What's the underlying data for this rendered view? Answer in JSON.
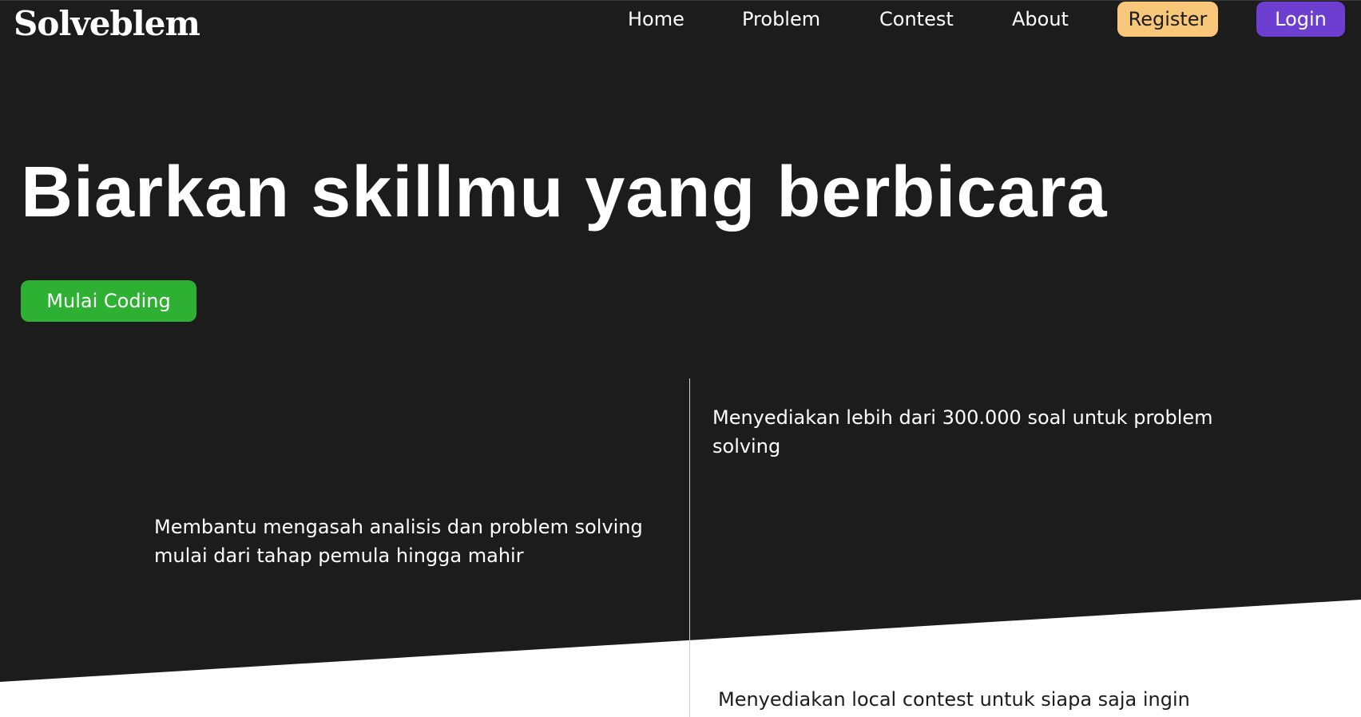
{
  "header": {
    "logo": "Solveblem",
    "nav": {
      "home": "Home",
      "problem": "Problem",
      "contest": "Contest",
      "about": "About"
    },
    "register_label": "Register",
    "login_label": "Login"
  },
  "hero": {
    "title": "Biarkan skillmu yang berbicara",
    "cta_label": "Mulai Coding"
  },
  "features": {
    "item1": "Menyediakan lebih dari 300.000 soal untuk problem solving",
    "item2": "Membantu mengasah analisis dan problem solving mulai dari tahap pemula hingga mahir",
    "item3": "Menyediakan local contest untuk siapa saja ingin"
  },
  "colors": {
    "background_dark": "#1c1c1c",
    "register_bg": "#f8c779",
    "login_bg": "#6c3fd1",
    "cta_bg": "#2eb032"
  }
}
